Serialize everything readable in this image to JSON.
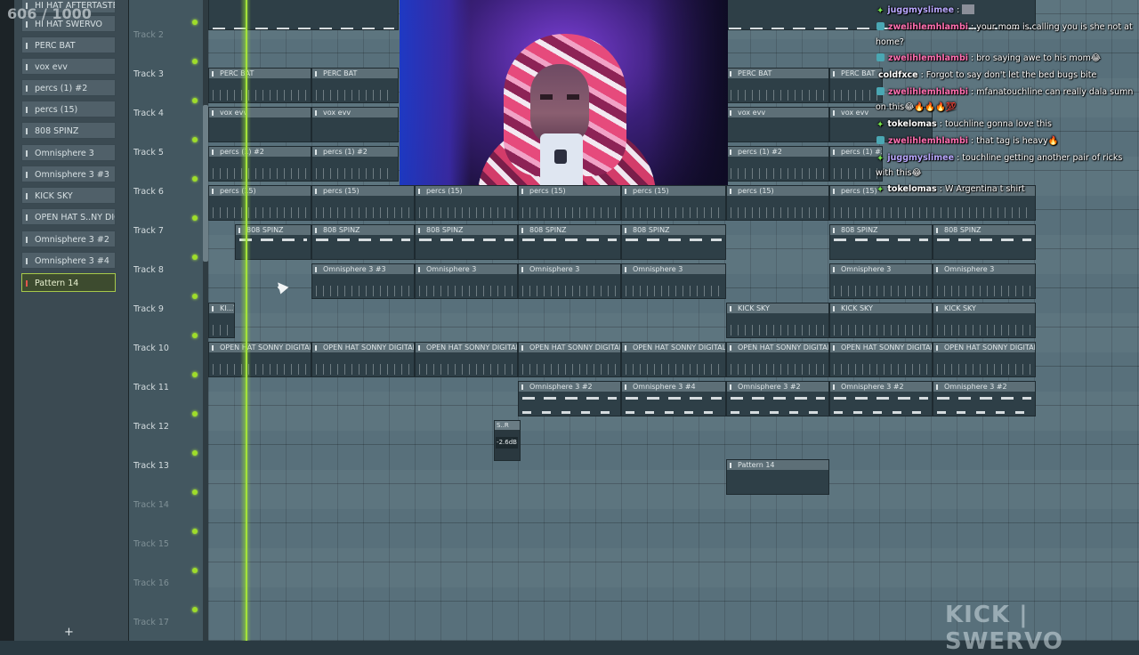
{
  "window": {
    "counter_text": "606 / 1000"
  },
  "picker": {
    "patterns": [
      {
        "label": "HI HAT AFTERTASTE"
      },
      {
        "label": "HI HAT SWERVO"
      },
      {
        "label": "PERC BAT"
      },
      {
        "label": "vox evv"
      },
      {
        "label": "percs (1) #2"
      },
      {
        "label": "percs (15)"
      },
      {
        "label": "808 SPINZ"
      },
      {
        "label": "Omnisphere 3"
      },
      {
        "label": "Omnisphere 3 #3"
      },
      {
        "label": "KICK SKY"
      },
      {
        "label": "OPEN HAT S..NY DIGITAL"
      },
      {
        "label": "Omnisphere 3 #2"
      },
      {
        "label": "Omnisphere 3 #4"
      },
      {
        "label": "Pattern 14"
      }
    ],
    "add_label": "+"
  },
  "tracks": [
    {
      "label": "Track 2"
    },
    {
      "label": "Track 3"
    },
    {
      "label": "Track 4"
    },
    {
      "label": "Track 5"
    },
    {
      "label": "Track 6"
    },
    {
      "label": "Track 7"
    },
    {
      "label": "Track 8"
    },
    {
      "label": "Track 9"
    },
    {
      "label": "Track 10"
    },
    {
      "label": "Track 11"
    },
    {
      "label": "Track 12"
    },
    {
      "label": "Track 13"
    },
    {
      "label": "Track 14"
    },
    {
      "label": "Track 15"
    },
    {
      "label": "Track 16"
    },
    {
      "label": "Track 17"
    }
  ],
  "clips": {
    "perc_bat": "PERC BAT",
    "vox_evv": "vox evv",
    "percs1_2": "percs (1) #2",
    "percs15": "percs (15)",
    "spinz": "808 SPINZ",
    "omni3_3": "Omnisphere 3 #3",
    "omni3": "Omnisphere 3",
    "kick_sky": "KICK SKY",
    "kick_short": "KI...Y",
    "open_hat": "OPEN HAT SONNY DIGITAL",
    "omni3_2": "Omnisphere 3 #2",
    "omni3_4": "Omnisphere 3 #4",
    "pattern14": "Pattern 14",
    "small_title": "S..R",
    "small_vol": "-2.6dB"
  },
  "chat": [
    {
      "user": "juggmyslimee",
      "text": " : ",
      "user_color": "#b9a8ff",
      "badge": "star"
    },
    {
      "user": "zwelihlemhlambi",
      "text": " : your mom is calling you is she not at home?",
      "user_color": "#ff6fb0",
      "badge": "b2"
    },
    {
      "user": "zwelihlemhlambi",
      "text": " : bro saying awe to his mom😂",
      "user_color": "#ff6fb0",
      "badge": "b2"
    },
    {
      "user": "coldfxce",
      "text": " : Forgot to say don't let the bed bugs bite",
      "user_color": "#ffffff",
      "badge": ""
    },
    {
      "user": "zwelihlemhlambi",
      "text": " : mfanatouchline can really dala sumn on this😂🔥🔥🔥💯",
      "user_color": "#ff6fb0",
      "badge": "b2"
    },
    {
      "user": "tokelomas",
      "text": " : touchline gonna love this",
      "user_color": "#ffffff",
      "badge": "star"
    },
    {
      "user": "zwelihlemhlambi",
      "text": " : that tag is heavy🔥",
      "user_color": "#ff6fb0",
      "badge": "b2"
    },
    {
      "user": "juggmyslimee",
      "text": " : touchline getting another pair of ricks with this😂",
      "user_color": "#b9a8ff",
      "badge": "star"
    },
    {
      "user": "tokelomas",
      "text": " : W Argentina t shirt",
      "user_color": "#ffffff",
      "badge": "star"
    }
  ],
  "watermark": "KICK | SWERVO",
  "colors": {
    "accent": "#a4e23a",
    "playlist_bg": "#58707b",
    "clip_bg": "#2e3f47"
  }
}
